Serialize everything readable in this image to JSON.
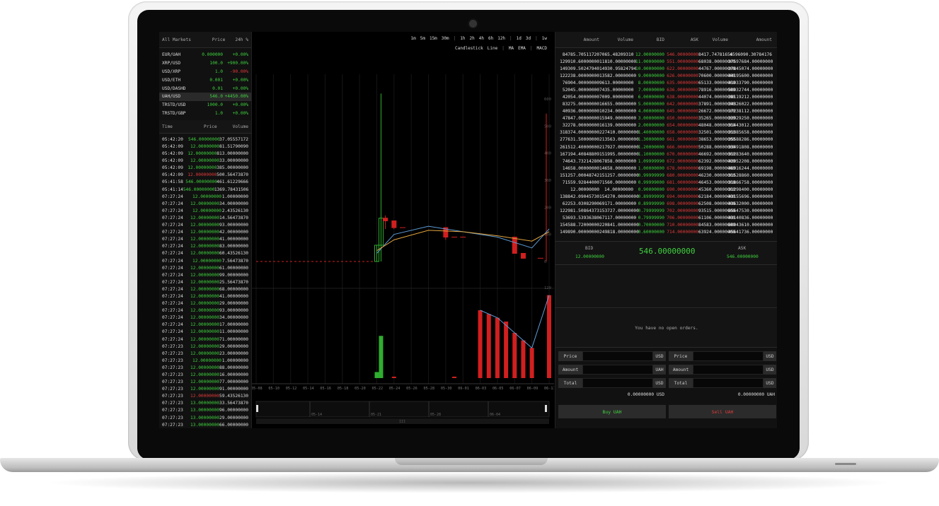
{
  "markets": {
    "header": {
      "name": "All Markets",
      "price": "Price",
      "change": "24h %"
    },
    "rows": [
      {
        "name": "EUR/UAH",
        "price": "0.000000",
        "change": "+0.00%",
        "cls": "green",
        "sel": false
      },
      {
        "name": "XRP/USD",
        "price": "100.0",
        "change": "+900.00%",
        "cls": "green",
        "sel": false
      },
      {
        "name": "USD/XRP",
        "price": "1.0",
        "change": "-90.00%",
        "cls": "red",
        "sel": false
      },
      {
        "name": "USD/ETH",
        "price": "0.001",
        "change": "+0.00%",
        "cls": "green",
        "sel": false
      },
      {
        "name": "USD/DASHD",
        "price": "0.01",
        "change": "+0.00%",
        "cls": "green",
        "sel": false
      },
      {
        "name": "UAH/USD",
        "price": "546.0",
        "change": "+4450.00%",
        "cls": "green",
        "sel": true
      },
      {
        "name": "TRSTD/USD",
        "price": "1000.0",
        "change": "+0.00%",
        "cls": "green",
        "sel": false
      },
      {
        "name": "TRSTD/GBP",
        "price": "1.0",
        "change": "+0.00%",
        "cls": "green",
        "sel": false
      }
    ]
  },
  "trades": {
    "header": {
      "time": "Time",
      "price": "Price",
      "volume": "Volume"
    },
    "rows": [
      {
        "t": "05:42:20",
        "p": "546.00000000",
        "v": "37.05557172",
        "c": "green"
      },
      {
        "t": "05:42:09",
        "p": "12.00000000",
        "v": "81.51790090",
        "c": "green"
      },
      {
        "t": "05:42:09",
        "p": "12.00000000",
        "v": "813.00000000",
        "c": "green"
      },
      {
        "t": "05:42:09",
        "p": "12.00000000",
        "v": "33.00000000",
        "c": "green"
      },
      {
        "t": "05:42:09",
        "p": "12.00000000",
        "v": "385.00000000",
        "c": "green"
      },
      {
        "t": "05:42:09",
        "p": "12.00000000",
        "v": "500.56473870",
        "c": "red"
      },
      {
        "t": "05:41:58",
        "p": "546.00000000",
        "v": "461.61229666",
        "c": "green"
      },
      {
        "t": "05:41:14",
        "p": "546.00000000",
        "v": "1369.78431506",
        "c": "green"
      },
      {
        "t": "07:27:24",
        "p": "12.00000000",
        "v": "1.00000000",
        "c": "green"
      },
      {
        "t": "07:27:24",
        "p": "12.00000000",
        "v": "34.00000000",
        "c": "green"
      },
      {
        "t": "07:27:24",
        "p": "12.00000000",
        "v": "2.43526130",
        "c": "green"
      },
      {
        "t": "07:27:24",
        "p": "12.00000000",
        "v": "14.56473870",
        "c": "green"
      },
      {
        "t": "07:27:24",
        "p": "12.00000000",
        "v": "93.00000000",
        "c": "green"
      },
      {
        "t": "07:27:24",
        "p": "12.00000000",
        "v": "42.00000000",
        "c": "green"
      },
      {
        "t": "07:27:24",
        "p": "12.00000000",
        "v": "41.00000000",
        "c": "green"
      },
      {
        "t": "07:27:24",
        "p": "12.00000000",
        "v": "83.00000000",
        "c": "green"
      },
      {
        "t": "07:27:24",
        "p": "12.00000000",
        "v": "60.43526130",
        "c": "green"
      },
      {
        "t": "07:27:24",
        "p": "12.00000000",
        "v": "7.56473870",
        "c": "green"
      },
      {
        "t": "07:27:24",
        "p": "12.00000000",
        "v": "61.00000000",
        "c": "green"
      },
      {
        "t": "07:27:24",
        "p": "12.00000000",
        "v": "99.00000000",
        "c": "green"
      },
      {
        "t": "07:27:24",
        "p": "12.00000000",
        "v": "25.56473870",
        "c": "green"
      },
      {
        "t": "07:27:24",
        "p": "12.00000000",
        "v": "68.00000000",
        "c": "green"
      },
      {
        "t": "07:27:24",
        "p": "12.00000000",
        "v": "41.00000000",
        "c": "green"
      },
      {
        "t": "07:27:24",
        "p": "12.00000000",
        "v": "29.00000000",
        "c": "green"
      },
      {
        "t": "07:27:24",
        "p": "12.00000000",
        "v": "93.00000000",
        "c": "green"
      },
      {
        "t": "07:27:24",
        "p": "12.00000000",
        "v": "34.00000000",
        "c": "green"
      },
      {
        "t": "07:27:24",
        "p": "12.00000000",
        "v": "17.00000000",
        "c": "green"
      },
      {
        "t": "07:27:24",
        "p": "12.00000000",
        "v": "11.00000000",
        "c": "green"
      },
      {
        "t": "07:27:24",
        "p": "12.00000000",
        "v": "71.00000000",
        "c": "green"
      },
      {
        "t": "07:27:23",
        "p": "12.00000000",
        "v": "29.00000000",
        "c": "green"
      },
      {
        "t": "07:27:23",
        "p": "12.00000000",
        "v": "23.00000000",
        "c": "green"
      },
      {
        "t": "07:27:23",
        "p": "12.00000000",
        "v": "1.00000000",
        "c": "green"
      },
      {
        "t": "07:27:23",
        "p": "12.00000000",
        "v": "88.00000000",
        "c": "green"
      },
      {
        "t": "07:27:23",
        "p": "12.00000000",
        "v": "16.00000000",
        "c": "green"
      },
      {
        "t": "07:27:23",
        "p": "12.00000000",
        "v": "77.00000000",
        "c": "green"
      },
      {
        "t": "07:27:23",
        "p": "12.00000000",
        "v": "91.00000000",
        "c": "green"
      },
      {
        "t": "07:27:23",
        "p": "12.00000000",
        "v": "59.43526130",
        "c": "red"
      },
      {
        "t": "07:27:23",
        "p": "13.00000000",
        "v": "33.56473870",
        "c": "green"
      },
      {
        "t": "07:27:23",
        "p": "13.00000000",
        "v": "96.00000000",
        "c": "green"
      },
      {
        "t": "07:27:23",
        "p": "13.00000000",
        "v": "29.00000000",
        "c": "green"
      },
      {
        "t": "07:27:23",
        "p": "13.00000000",
        "v": "66.00000000",
        "c": "green"
      }
    ]
  },
  "chart": {
    "timeframes": [
      "1m",
      "5m",
      "15m",
      "30m",
      "|",
      "1h",
      "2h",
      "4h",
      "6h",
      "12h",
      "|",
      "1d",
      "3d",
      "|",
      "1w"
    ],
    "modes": [
      "Candlestick",
      "Line",
      "|",
      "MA",
      "EMA",
      "|",
      "MACD"
    ],
    "price_ticks": [
      "600",
      "500",
      "400",
      "300",
      "200",
      "100",
      "0"
    ],
    "volume_ticks": [
      "120"
    ],
    "x_ticks": [
      "05-08",
      "05-10",
      "05-12",
      "05-14",
      "05-16",
      "05-18",
      "05-20",
      "05-22",
      "05-24",
      "05-26",
      "05-28",
      "05-30",
      "06-01",
      "06-03",
      "06-05",
      "06-07",
      "06-09",
      "06-11"
    ],
    "nav_ticks": [
      "05-14",
      "05-21",
      "05-28",
      "06-04"
    ],
    "nav_handle": "III",
    "colors": {
      "up": "#2fae2f",
      "down": "#d11f1f",
      "ma": "#5b9bd5",
      "ema": "#e2a33d"
    }
  },
  "chart_data": {
    "type": "candlestick",
    "x": [
      "05-08",
      "05-10",
      "05-12",
      "05-14",
      "05-16",
      "05-18",
      "05-20",
      "05-22",
      "05-23",
      "05-24",
      "05-26",
      "05-28",
      "05-30",
      "06-01",
      "06-03",
      "06-05",
      "06-07",
      "06-08",
      "06-09",
      "06-11"
    ],
    "candles": [
      {
        "x": "05-22",
        "open": 0,
        "high": 60,
        "low": 0,
        "close": 60
      },
      {
        "x": "05-22",
        "open": 60,
        "high": 620,
        "low": 0,
        "close": 160
      },
      {
        "x": "05-23",
        "open": 160,
        "high": 170,
        "low": 120,
        "close": 150
      },
      {
        "x": "05-24",
        "open": 150,
        "high": 150,
        "low": 120,
        "close": 125
      },
      {
        "x": "05-30",
        "open": 125,
        "high": 125,
        "low": 80,
        "close": 90
      },
      {
        "x": "06-07",
        "open": 90,
        "high": 90,
        "low": 30,
        "close": 30
      },
      {
        "x": "06-08",
        "open": 30,
        "high": 30,
        "low": 10,
        "close": 12
      }
    ],
    "volume_bars": [
      {
        "x": "05-22",
        "value": 8,
        "dir": "up"
      },
      {
        "x": "05-22",
        "value": 56,
        "dir": "up"
      },
      {
        "x": "06-03",
        "value": 90,
        "dir": "down"
      },
      {
        "x": "06-04",
        "value": 85,
        "dir": "down"
      },
      {
        "x": "06-05",
        "value": 80,
        "dir": "down"
      },
      {
        "x": "06-06",
        "value": 75,
        "dir": "down"
      },
      {
        "x": "06-07",
        "value": 60,
        "dir": "down"
      },
      {
        "x": "06-08",
        "value": 50,
        "dir": "down"
      },
      {
        "x": "06-09",
        "value": 40,
        "dir": "down"
      },
      {
        "x": "06-11",
        "value": 110,
        "dir": "down"
      }
    ],
    "ylim": [
      0,
      600
    ],
    "volume_ylim": [
      0,
      120
    ]
  },
  "orderbook": {
    "header": {
      "amount_bid": "Amount",
      "volume_bid": "Volume",
      "bid": "BID",
      "ask": "ASK",
      "volume_ask": "Volume",
      "amount_ask": "Amount"
    },
    "rows": [
      [
        "84785.70511720",
        "7065.48209310",
        "12.00000000",
        "546.00000000",
        "8417.74781656",
        "4596090.30784176"
      ],
      [
        "129910.60000000",
        "11810.00000000",
        "11.00000000",
        "551.00000000",
        "68038.00000000",
        "37597684.00000000"
      ],
      [
        "149309.50247940",
        "14930.95824794",
        "10.00000000",
        "622.00000000",
        "44767.00000000",
        "27845074.00000000"
      ],
      [
        "122238.00000000",
        "13582.00000000",
        "9.00000000",
        "626.00000000",
        "70600.00000000",
        "44195600.00000000"
      ],
      [
        "76904.00000000",
        "9613.00000000",
        "8.00000000",
        "635.00000000",
        "65133.00000000",
        "41033790.00000000"
      ],
      [
        "52045.00000000",
        "7435.00000000",
        "7.00000000",
        "636.00000000",
        "78916.00000000",
        "50032744.00000000"
      ],
      [
        "42054.00000000",
        "7009.00000000",
        "6.00000000",
        "638.00000000",
        "44074.00000000",
        "28119212.00000000"
      ],
      [
        "83275.00000000",
        "16655.00000000",
        "5.00000000",
        "642.00000000",
        "37891.00000000",
        "24326022.00000000"
      ],
      [
        "40936.00000000",
        "10234.00000000",
        "4.00000000",
        "645.00000000",
        "26672.00000000",
        "17238112.00000000"
      ],
      [
        "47847.00000000",
        "15949.00000000",
        "3.00000000",
        "650.00000000",
        "35265.00000000",
        "22929250.00000000"
      ],
      [
        "32278.00000000",
        "16139.00000000",
        "2.00000000",
        "654.00000000",
        "48048.00000000",
        "31443012.00000000"
      ],
      [
        "318374.00000000",
        "227410.00000000",
        "1.40000000",
        "658.00000000",
        "32501.00000000",
        "21385658.00000000"
      ],
      [
        "277631.50000000",
        "213563.00000000",
        "1.30000000",
        "661.00000000",
        "38653.00000000",
        "25588286.00000000"
      ],
      [
        "261512.40000000",
        "217927.00000000",
        "1.20000000",
        "666.00000000",
        "50288.00000000",
        "33491808.00000000"
      ],
      [
        "167194.40848809",
        "151995.00000000",
        "1.10000000",
        "670.00000000",
        "46692.00000000",
        "31283640.00000000"
      ],
      [
        "74643.73214280",
        "67858.00000000",
        "1.09999990",
        "672.00000000",
        "62392.00000000",
        "42052208.00000000"
      ],
      [
        "14658.00000000",
        "14658.00000000",
        "1.00000000",
        "678.00000000",
        "69198.00000000",
        "46916244.00000000"
      ],
      [
        "151257.00048742",
        "151257.00000000",
        "0.99999999",
        "680.00000000",
        "46230.00000000",
        "31528860.00000000"
      ],
      [
        "71559.92844000",
        "71560.00000000",
        "0.99999000",
        "681.00000000",
        "46453.00000000",
        "31866758.00000000"
      ],
      [
        "12.00000000",
        "14.00000000",
        "0.90000000",
        "690.00000000",
        "45360.00000000",
        "31298400.00000000"
      ],
      [
        "138842.09045730",
        "154270.00000000",
        "0.89999999",
        "694.00000000",
        "62184.00000000",
        "43155696.00000000"
      ],
      [
        "62253.03082900",
        "69171.00000000",
        "0.89999990",
        "698.00000000",
        "62508.00000000",
        "43632000.00000000"
      ],
      [
        "122981.50864373",
        "153727.00000000",
        "0.79999999",
        "702.00000000",
        "93515.00000000",
        "65647530.00000000"
      ],
      [
        "53693.53936380",
        "67117.00000000",
        "0.79999990",
        "706.00000000",
        "61106.00000000",
        "43140836.00000000"
      ],
      [
        "154588.72000000",
        "220841.00000000",
        "0.70000000",
        "710.00000000",
        "84583.00000000",
        "60043610.00000000"
      ],
      [
        "149890.00000000",
        "249818.00000000",
        "0.60000000",
        "714.00000000",
        "63924.00000000",
        "45641736.00000000"
      ]
    ]
  },
  "spread": {
    "bid_label": "BID",
    "bid_value": "12.00000000",
    "last": "546.00000000",
    "ask_label": "ASK",
    "ask_value": "546.00000000"
  },
  "orders": {
    "empty": "You have no open orders."
  },
  "buy": {
    "price_label": "Price",
    "price_cur": "USD",
    "amount_label": "Amount",
    "amount_cur": "UAH",
    "total_label": "Total",
    "total_cur": "USD",
    "total_value": "0.00000000 USD",
    "button": "Buy UAH"
  },
  "sell": {
    "price_label": "Price",
    "price_cur": "USD",
    "amount_label": "Amount",
    "amount_cur": "USD",
    "total_label": "Total",
    "total_cur": "USD",
    "total_value": "0.00000000 UAH",
    "button": "Sell UAH"
  }
}
